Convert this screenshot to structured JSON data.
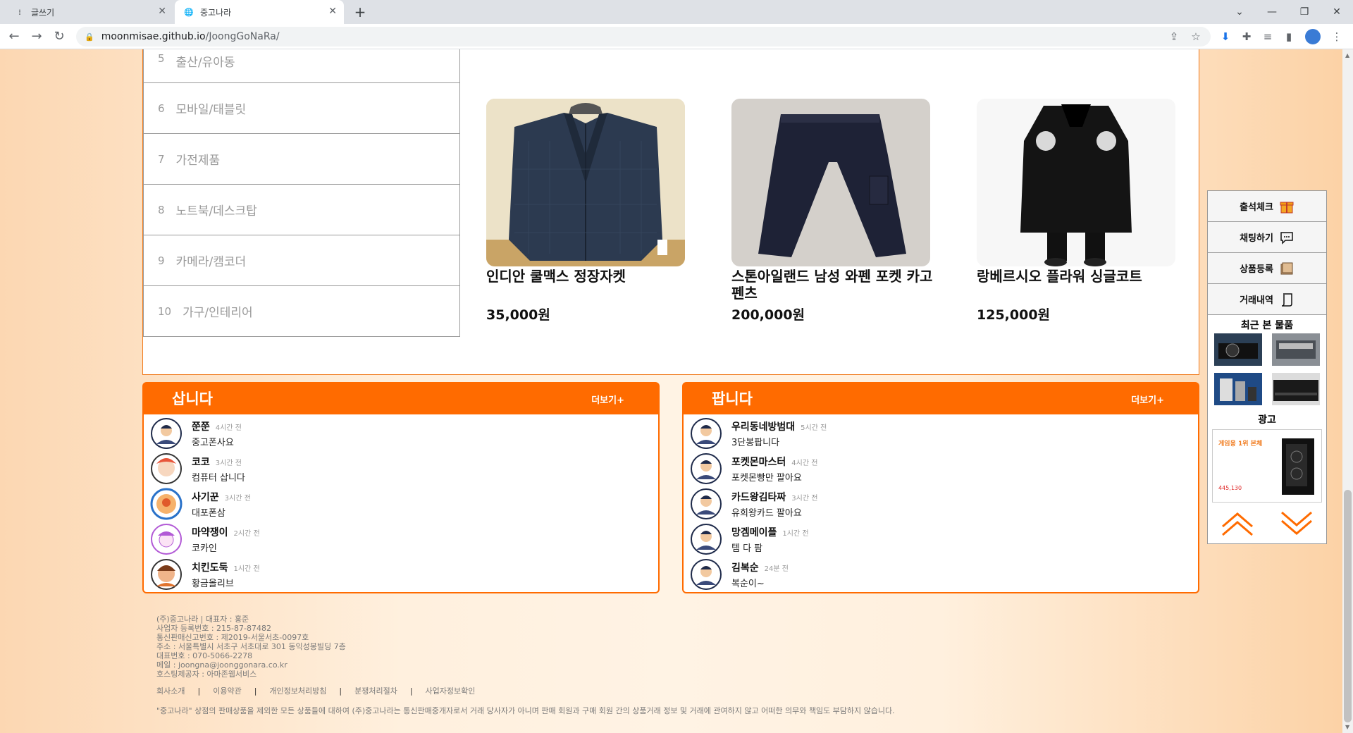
{
  "browser": {
    "tabs": [
      {
        "title": "글쓰기",
        "active": false
      },
      {
        "title": "중고나라",
        "active": true
      }
    ],
    "url_host": "moonmisae.github.io",
    "url_path": "/JoongGoNaRa/"
  },
  "categories": [
    {
      "num": "5",
      "label": "출산/유아동"
    },
    {
      "num": "6",
      "label": "모바일/태블릿"
    },
    {
      "num": "7",
      "label": "가전제품"
    },
    {
      "num": "8",
      "label": "노트북/데스크탑"
    },
    {
      "num": "9",
      "label": "카메라/캠코더"
    },
    {
      "num": "10",
      "label": "가구/인테리어"
    }
  ],
  "products": [
    {
      "name": "인디안 쿨맥스 정장자켓",
      "price": "35,000원"
    },
    {
      "name": "스톤아일랜드 남성 와펜 포켓 카고 펜츠",
      "price": "200,000원"
    },
    {
      "name": "랑베르시오 플라워 싱글코트",
      "price": "125,000원"
    }
  ],
  "buy_board": {
    "title": "삽니다",
    "more": "더보기+",
    "posts": [
      {
        "nick": "쭌쭌",
        "time": "4시간 전",
        "msg": "중고폰사요"
      },
      {
        "nick": "코코",
        "time": "3시간 전",
        "msg": "컴퓨터 삽니다"
      },
      {
        "nick": "사기꾼",
        "time": "3시간 전",
        "msg": "대포폰삼"
      },
      {
        "nick": "마약쟁이",
        "time": "2시간 전",
        "msg": "코카인"
      },
      {
        "nick": "치킨도둑",
        "time": "1시간 전",
        "msg": "황금올리브"
      }
    ]
  },
  "sell_board": {
    "title": "팝니다",
    "more": "더보기+",
    "posts": [
      {
        "nick": "우리동네방범대",
        "time": "5시간 전",
        "msg": "3단봉팝니다"
      },
      {
        "nick": "포켓몬마스터",
        "time": "4시간 전",
        "msg": "포켓몬빵만 팔아요"
      },
      {
        "nick": "카드왕김타짜",
        "time": "3시간 전",
        "msg": "유희왕카드 팔아요"
      },
      {
        "nick": "망겜메이플",
        "time": "1시간 전",
        "msg": "템 다 팜"
      },
      {
        "nick": "김복순",
        "time": "24분 전",
        "msg": "복순이~"
      }
    ]
  },
  "footer": {
    "lines": [
      "(주)중고나라 | 대표자 : 홍준",
      "사업자 등록번호 : 215-87-87482",
      "통신판매신고번호 : 제2019-서울서초-0097호",
      "주소 : 서울특별시 서초구 서초대로 301 동익성봉빌딩 7층",
      "대표번호 : 070-5066-2278",
      "메일 : joongna@joonggonara.co.kr",
      "호스팅제공자 : 아마존웹서비스"
    ],
    "links": [
      "회사소개",
      "이용약관",
      "개인정보처리방침",
      "분쟁처리절차",
      "사업자정보확인"
    ],
    "notice": "\"중고나라\" 상점의 판매상품을 제외한 모든 상품들에 대하여 (주)중고나라는 통신판매중개자로서 거래 당사자가 아니며 판매 회원과 구매 회원 간의 상품거래 정보 및 거래에 관여하지 않고 어떠한 의무와 책임도 부담하지 않습니다."
  },
  "sidebar": {
    "buttons": [
      "출석체크",
      "채팅하기",
      "상품등록",
      "거래내역"
    ],
    "recent_title": "최근 본 물품",
    "ad_title": "광고",
    "ad_headline": "게임용 1위 본체",
    "ad_price": "445,130"
  },
  "colors": {
    "accent": "#ff6b00",
    "footer_gradient_left": "#fcd7b2",
    "footer_gradient_right": "#fcd2a6"
  }
}
